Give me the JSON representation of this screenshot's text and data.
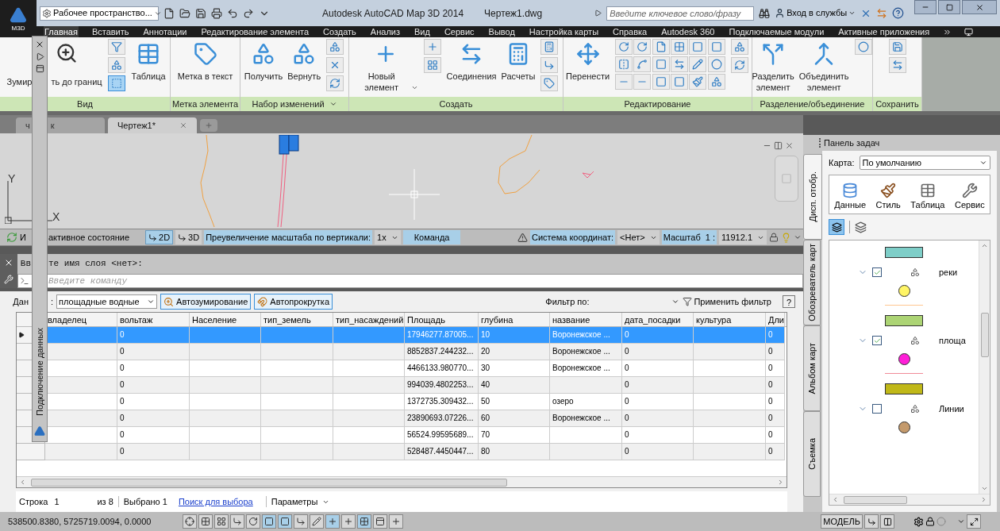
{
  "title_bar": {
    "logo_label": "M3D",
    "workspace": "Рабочее пространство...",
    "app_title": "Autodesk AutoCAD Map 3D 2014",
    "file_name": "Чертеж1.dwg",
    "search_placeholder": "Введите ключевое слово/фразу",
    "sign_in": "Вход в службы"
  },
  "menu": [
    {
      "label": "Главная",
      "selected": true
    },
    {
      "label": "Вставить",
      "selected": false
    },
    {
      "label": "Аннотации",
      "selected": false
    },
    {
      "label": "Редактирование элемента",
      "selected": false
    },
    {
      "label": "Создать",
      "selected": false
    },
    {
      "label": "Анализ",
      "selected": false
    },
    {
      "label": "Вид",
      "selected": false
    },
    {
      "label": "Сервис",
      "selected": false
    },
    {
      "label": "Вывод",
      "selected": false
    },
    {
      "label": "Настройка карты",
      "selected": false
    },
    {
      "label": "Справка",
      "selected": false
    },
    {
      "label": "Autodesk 360",
      "selected": false
    },
    {
      "label": "Подключаемые модули",
      "selected": false
    },
    {
      "label": "Активные приложения",
      "selected": false
    }
  ],
  "ribbon": [
    {
      "label": "Вид",
      "menu": false,
      "items": [
        {
          "kind": "covered",
          "label": "Зумир",
          "label_after": "ть до границ"
        },
        {
          "kind": "tools"
        },
        {
          "kind": "large",
          "label": "Таблица"
        }
      ]
    },
    {
      "label": "Метка элемента",
      "menu": false,
      "items": [
        {
          "kind": "large",
          "label": "Метка в текст"
        }
      ]
    },
    {
      "label": "Набор изменений",
      "menu": true,
      "items": [
        {
          "kind": "large",
          "label": "Получить"
        },
        {
          "kind": "large",
          "label": "Вернуть"
        },
        {
          "kind": "tools"
        }
      ]
    },
    {
      "label": "Создать",
      "menu": false,
      "items": [
        {
          "kind": "large",
          "label": "Новый элемент",
          "dropdown": true
        },
        {
          "kind": "tools"
        },
        {
          "kind": "large",
          "label": "Соединения"
        },
        {
          "kind": "large",
          "label": "Расчеты"
        },
        {
          "kind": "tools"
        }
      ]
    },
    {
      "label": "Редактирование",
      "menu": false,
      "items": [
        {
          "kind": "large",
          "label": "Перенести"
        },
        {
          "kind": "tools"
        },
        {
          "kind": "tools"
        }
      ]
    },
    {
      "label": "Разделение/объединение",
      "menu": false,
      "items": [
        {
          "kind": "large",
          "label": "Разделить элемент"
        },
        {
          "kind": "large",
          "label": "Объединить элемент"
        },
        {
          "kind": "tools"
        }
      ]
    },
    {
      "label": "Сохранить",
      "menu": false,
      "items": [
        {
          "kind": "tools"
        }
      ]
    }
  ],
  "floating_panel": {
    "title": "Подключение данных"
  },
  "doc_tabs": [
    {
      "label": "ч",
      "label_after": "к",
      "selected": false
    },
    {
      "label": "Чертеж1*",
      "selected": true
    }
  ],
  "canvas": {
    "y_label": "Y",
    "x_label": "X"
  },
  "canvas_status": {
    "state_prefix": "И",
    "state": "активное состояние",
    "modes": [
      {
        "label": "2D",
        "selected": true
      },
      {
        "label": "3D",
        "selected": false
      }
    ],
    "exaggeration_label": "Преувеличение масштаба по вертикали:",
    "exaggeration": "1x",
    "command": "Команда",
    "cs_label": "Система координат:",
    "cs_value": "<Нет>",
    "scale_label": "Масштаб  1 :",
    "scale_value": "11912.1"
  },
  "command_line": {
    "history_prefix": "Вв",
    "history": "те имя слоя <нет>:",
    "placeholder": "Введите команду"
  },
  "data_view": {
    "source_prefix": "Дан",
    "source_suffix": ":",
    "source": "площадные водные",
    "toggles": [
      {
        "label": "Автозумирование",
        "on": true
      },
      {
        "label": "Автопрокрутка",
        "on": true
      }
    ],
    "filter_label": "Фильтр по:",
    "apply_filter": "Применить фильтр",
    "help": "?"
  },
  "table": {
    "columns": [
      "владелец",
      "вольтаж",
      "Население",
      "тип_земель",
      "тип_насаждений",
      "Площадь",
      "глубина",
      "название",
      "дата_посадки",
      "культура",
      "Дли"
    ],
    "rows": [
      {
        "selected": true,
        "cells": [
          "",
          "0",
          "",
          "",
          "",
          "17946277.87005...",
          "10",
          "Воронежское ...",
          "0",
          "",
          "0"
        ]
      },
      {
        "selected": false,
        "cells": [
          "",
          "0",
          "",
          "",
          "",
          "8852837.244232...",
          "20",
          "Воронежское ...",
          "0",
          "",
          "0"
        ]
      },
      {
        "selected": false,
        "cells": [
          "",
          "0",
          "",
          "",
          "",
          "4466133.980770...",
          "30",
          "Воронежское ...",
          "0",
          "",
          "0"
        ]
      },
      {
        "selected": false,
        "cells": [
          "",
          "0",
          "",
          "",
          "",
          "994039.4802253...",
          "40",
          "",
          "0",
          "",
          "0"
        ]
      },
      {
        "selected": false,
        "cells": [
          "",
          "0",
          "",
          "",
          "",
          "1372735.309432...",
          "50",
          "озеро",
          "0",
          "",
          "0"
        ]
      },
      {
        "selected": false,
        "cells": [
          "",
          "0",
          "",
          "",
          "",
          "23890693.07226...",
          "60",
          "Воронежское ...",
          "0",
          "",
          "0"
        ]
      },
      {
        "selected": false,
        "cells": [
          "",
          "0",
          "",
          "",
          "",
          "56524.99595689...",
          "70",
          "",
          "0",
          "",
          "0"
        ]
      },
      {
        "selected": false,
        "cells": [
          "",
          "0",
          "",
          "",
          "",
          "528487.4450447...",
          "80",
          "",
          "0",
          "",
          "0"
        ]
      }
    ]
  },
  "record_bar": {
    "row_label": "Строка",
    "row_value": "1",
    "of": "из 8",
    "selected": "Выбрано 1",
    "search_link": "Поиск для выбора",
    "options": "Параметры"
  },
  "status_bar": {
    "coordinates": "538500.8380, 5725719.0094, 0.0000",
    "model": "МОДЕЛЬ"
  },
  "task_pane": {
    "title": "Панель задач",
    "tabs": [
      {
        "label": "Дисп. отобр.",
        "selected": true
      },
      {
        "label": "Обозреватель карт",
        "selected": false
      },
      {
        "label": "Альбом карт",
        "selected": false
      },
      {
        "label": "Съемка",
        "selected": false
      }
    ],
    "map_label": "Карта:",
    "map_value": "По умолчанию",
    "tools": [
      "Данные",
      "Стиль",
      "Таблица",
      "Сервис"
    ],
    "legend": [
      {
        "kind": "area",
        "color": "#7ecec8"
      },
      {
        "kind": "layer",
        "name": "реки",
        "checked": true
      },
      {
        "kind": "point",
        "color": "#fff566"
      },
      {
        "kind": "line",
        "color": "#ffc690"
      },
      {
        "kind": "area",
        "color": "#acd474"
      },
      {
        "kind": "layer",
        "name": "площа",
        "checked": true
      },
      {
        "kind": "point",
        "color": "#ff1ed8"
      },
      {
        "kind": "line",
        "color": "#f08a98"
      },
      {
        "kind": "area",
        "color": "#c0b818"
      },
      {
        "kind": "layer",
        "name": "Линии",
        "checked": false
      },
      {
        "kind": "point",
        "color": "#c49a6c"
      }
    ]
  }
}
